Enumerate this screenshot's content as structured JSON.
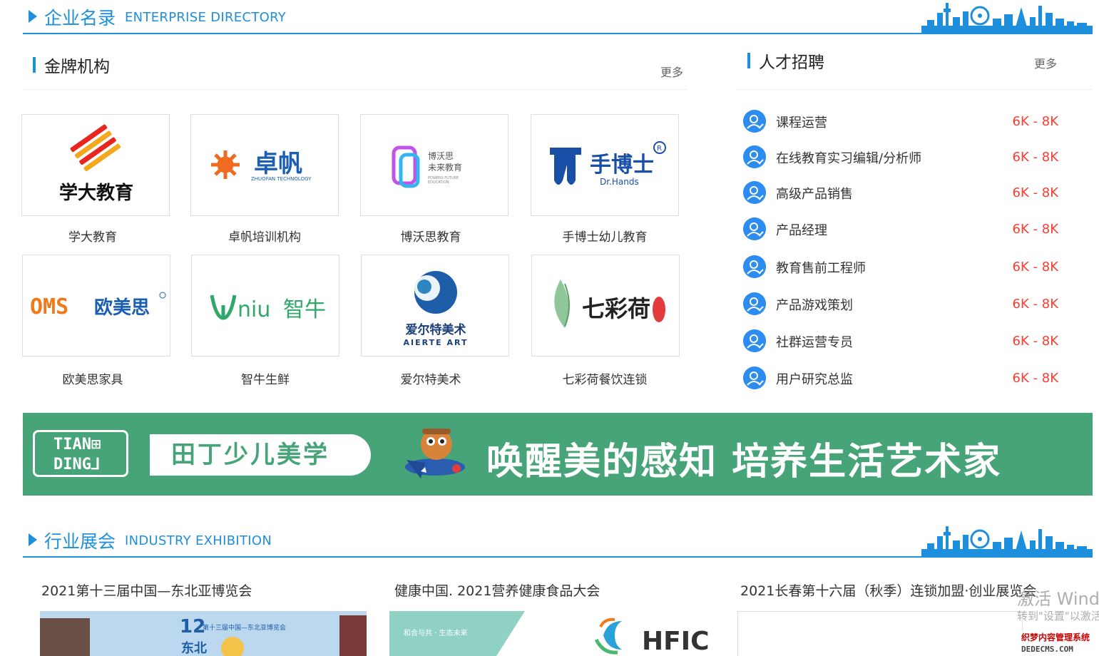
{
  "enterprise_section": {
    "zh": "企业名录",
    "en": "ENTERPRISE DIRECTORY"
  },
  "gold": {
    "title": "金牌机构",
    "more": "更多",
    "items": [
      {
        "name": "学大教育",
        "logo_text": "学大教育"
      },
      {
        "name": "卓帆培训机构",
        "logo_text": "卓帆",
        "logo_sub": "ZHUOFAN TECHNOLOGY"
      },
      {
        "name": "博沃思教育",
        "logo_text": "博沃思\n未来教育",
        "logo_sub": "POWERS FUTURE EDUCATION"
      },
      {
        "name": "手博士幼儿教育",
        "logo_text": "手博士",
        "logo_sub": "Dr.Hands"
      },
      {
        "name": "欧美思家具",
        "logo_text": "欧美思",
        "logo_sub": "OMS"
      },
      {
        "name": "智牛生鲜",
        "logo_text": "智牛",
        "logo_sub": "niu"
      },
      {
        "name": "爱尔特美术",
        "logo_text": "爱尔特美术",
        "logo_sub": "AIERTE ART"
      },
      {
        "name": "七彩荷餐饮连锁",
        "logo_text": "七彩荷"
      }
    ]
  },
  "jobs": {
    "title": "人才招聘",
    "more": "更多",
    "items": [
      {
        "title": "课程运营",
        "salary": "6K - 8K"
      },
      {
        "title": "在线教育实习编辑/分析师",
        "salary": "6K - 8K"
      },
      {
        "title": "高级产品销售",
        "salary": "6K - 8K"
      },
      {
        "title": "产品经理",
        "salary": "6K - 8K"
      },
      {
        "title": "教育售前工程师",
        "salary": "6K - 8K"
      },
      {
        "title": "产品游戏策划",
        "salary": "6K - 8K"
      },
      {
        "title": "社群运营专员",
        "salary": "6K - 8K"
      },
      {
        "title": "用户研究总监",
        "salary": "6K - 8K"
      }
    ]
  },
  "banner": {
    "logo": "TIANDING",
    "brand": "田丁少儿美学",
    "slogan": "唤醒美的感知 培养生活艺术家"
  },
  "exhibition_section": {
    "zh": "行业展会",
    "en": "INDUSTRY EXHIBITION"
  },
  "exhibitions": [
    {
      "title": "2021第十三届中国—东北亚博览会",
      "img_text": "第十三届中国—东北亚博览会"
    },
    {
      "title": "健康中国. 2021营养健康食品大会",
      "img_text": "和合与共 · 生态未来",
      "img_brand": "HFIC"
    },
    {
      "title": "2021长春第十六届（秋季）连锁加盟·创业展览会"
    }
  ],
  "overlay": {
    "activate_line1": "激活 Windows",
    "activate_line2": "转到\"设置\"以激活",
    "dede_line1": "织梦内容管理系统",
    "dede_line2": "DEDECMS.COM"
  },
  "colors": {
    "accent": "#1e8fdc",
    "salary": "#ff3b30",
    "banner_bg": "#47a478"
  }
}
